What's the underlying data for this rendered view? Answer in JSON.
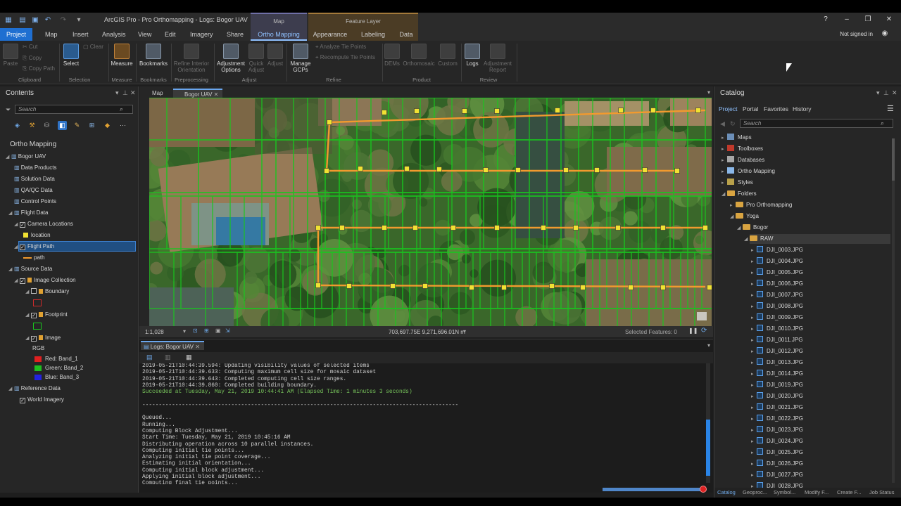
{
  "app": {
    "title": "ArcGIS Pro - Pro Orthomapping - Logs: Bogor UAV",
    "context_headers": {
      "map": "Map",
      "feature_layer": "Feature Layer"
    },
    "help": "?",
    "signed_in": "Not signed in"
  },
  "ribbon_tabs": [
    "Project",
    "Map",
    "Insert",
    "Analysis",
    "View",
    "Edit",
    "Imagery",
    "Share",
    "Ortho Mapping",
    "Appearance",
    "Labeling",
    "Data"
  ],
  "ribbon": {
    "clipboard": {
      "paste": "Paste",
      "cut": "Cut",
      "copy": "Copy",
      "copy_path": "Copy Path",
      "label": "Clipboard"
    },
    "selection": {
      "select": "Select",
      "clear": "Clear",
      "label": "Selection"
    },
    "measure": {
      "measure": "Measure",
      "label": "Measure"
    },
    "bookmarks": {
      "bookmarks": "Bookmarks",
      "label": "Bookmarks"
    },
    "preprocessing": {
      "refine": "Refine Interior Orientation",
      "label": "Preprocessing"
    },
    "adjust": {
      "options": "Adjustment Options",
      "quick": "Quick Adjust",
      "adjust": "Adjust",
      "label": "Adjust"
    },
    "refine": {
      "gcps": "Manage GCPs",
      "analyze": "Analyze Tie Points",
      "recompute": "Recompute Tie Points",
      "label": "Refine"
    },
    "product": {
      "dems": "DEMs",
      "ortho": "Orthomosaic",
      "custom": "Custom",
      "label": "Product"
    },
    "review": {
      "logs": "Logs",
      "report": "Adjustment Report",
      "label": "Review"
    }
  },
  "contents": {
    "title": "Contents",
    "search_placeholder": "Search",
    "heading": "Ortho Mapping",
    "tree": {
      "bogor": "Bogor UAV",
      "data_products": "Data Products",
      "solution_data": "Solution Data",
      "qaqc": "QA/QC Data",
      "control_points": "Control Points",
      "flight_data": "Flight Data",
      "camera_locations": "Camera Locations",
      "location": "location",
      "flight_path": "Flight Path",
      "path": "path",
      "source_data": "Source Data",
      "image_collection": "Image Collection",
      "boundary": "Boundary",
      "footprint": "Footprint",
      "image": "Image",
      "rgb": "RGB",
      "red": "Red:  Band_1",
      "green": "Green: Band_2",
      "blue": "Blue:  Band_3",
      "reference_data": "Reference Data",
      "world_imagery": "World Imagery"
    }
  },
  "map_view": {
    "tabs": [
      "Map",
      "Bogor UAV"
    ],
    "scale": "1:1,028",
    "coordinates": "703,697.75E 9,271,696.01N m",
    "selected_features": "Selected Features: 0"
  },
  "logs": {
    "tab": "Logs: Bogor UAV",
    "lines": [
      "2019-05-21T10:44:39.594: Updating visibility values of selected items",
      "2019-05-21T10:44:39.633: Computing maximum cell size for mosaic dataset",
      "2019-05-21T10:44:39.643: Completed computing cell size ranges.",
      "2019-05-21T10:44:39.860: Completed building boundary.",
      "Succeeded at Tuesday, May 21, 2019 10:44:41 AM (Elapsed Time: 1 minutes 3 seconds)",
      "",
      "------------------------------------------------------------------------------------------------",
      "",
      "Queued...",
      "Running...",
      "Computing Block Adjustment...",
      "Start Time: Tuesday, May 21, 2019 10:45:16 AM",
      "Distributing operation across 10 parallel instances.",
      "Computing initial tie points...",
      "Analyzing initial tie point coverage...",
      "Estimating initial orientation...",
      "Computing initial block adjustment...",
      "Applying initial block adjustment...",
      "Computing final tie points..."
    ],
    "success_line_index": 4
  },
  "catalog": {
    "title": "Catalog",
    "tabs": [
      "Project",
      "Portal",
      "Favorites",
      "History"
    ],
    "search_placeholder": "Search",
    "items": {
      "maps": "Maps",
      "toolboxes": "Toolboxes",
      "databases": "Databases",
      "ortho_mapping": "Ortho Mapping",
      "styles": "Styles",
      "folders": "Folders",
      "pro_ortho": "Pro Orthomapping",
      "yoga": "Yoga",
      "bogor": "Bogor",
      "raw": "RAW"
    },
    "files": [
      "DJI_0003.JPG",
      "DJI_0004.JPG",
      "DJI_0005.JPG",
      "DJI_0006.JPG",
      "DJI_0007.JPG",
      "DJI_0008.JPG",
      "DJI_0009.JPG",
      "DJI_0010.JPG",
      "DJI_0011.JPG",
      "DJI_0012.JPG",
      "DJI_0013.JPG",
      "DJI_0014.JPG",
      "DJI_0019.JPG",
      "DJI_0020.JPG",
      "DJI_0021.JPG",
      "DJI_0022.JPG",
      "DJI_0023.JPG",
      "DJI_0024.JPG",
      "DJI_0025.JPG",
      "DJI_0026.JPG",
      "DJI_0027.JPG",
      "DJI_0028.JPG"
    ],
    "bottom_tabs": [
      "Catalog",
      "Geoproc...",
      "Symbol...",
      "Modify F...",
      "Create F...",
      "Job Status"
    ]
  },
  "colors": {
    "accent": "#1f6fd1",
    "footprint": "#19c81e",
    "flight_path": "#f29a2e",
    "camera": "#f1e233",
    "boundary": "#d02a2a",
    "log_success": "#76c25a"
  }
}
